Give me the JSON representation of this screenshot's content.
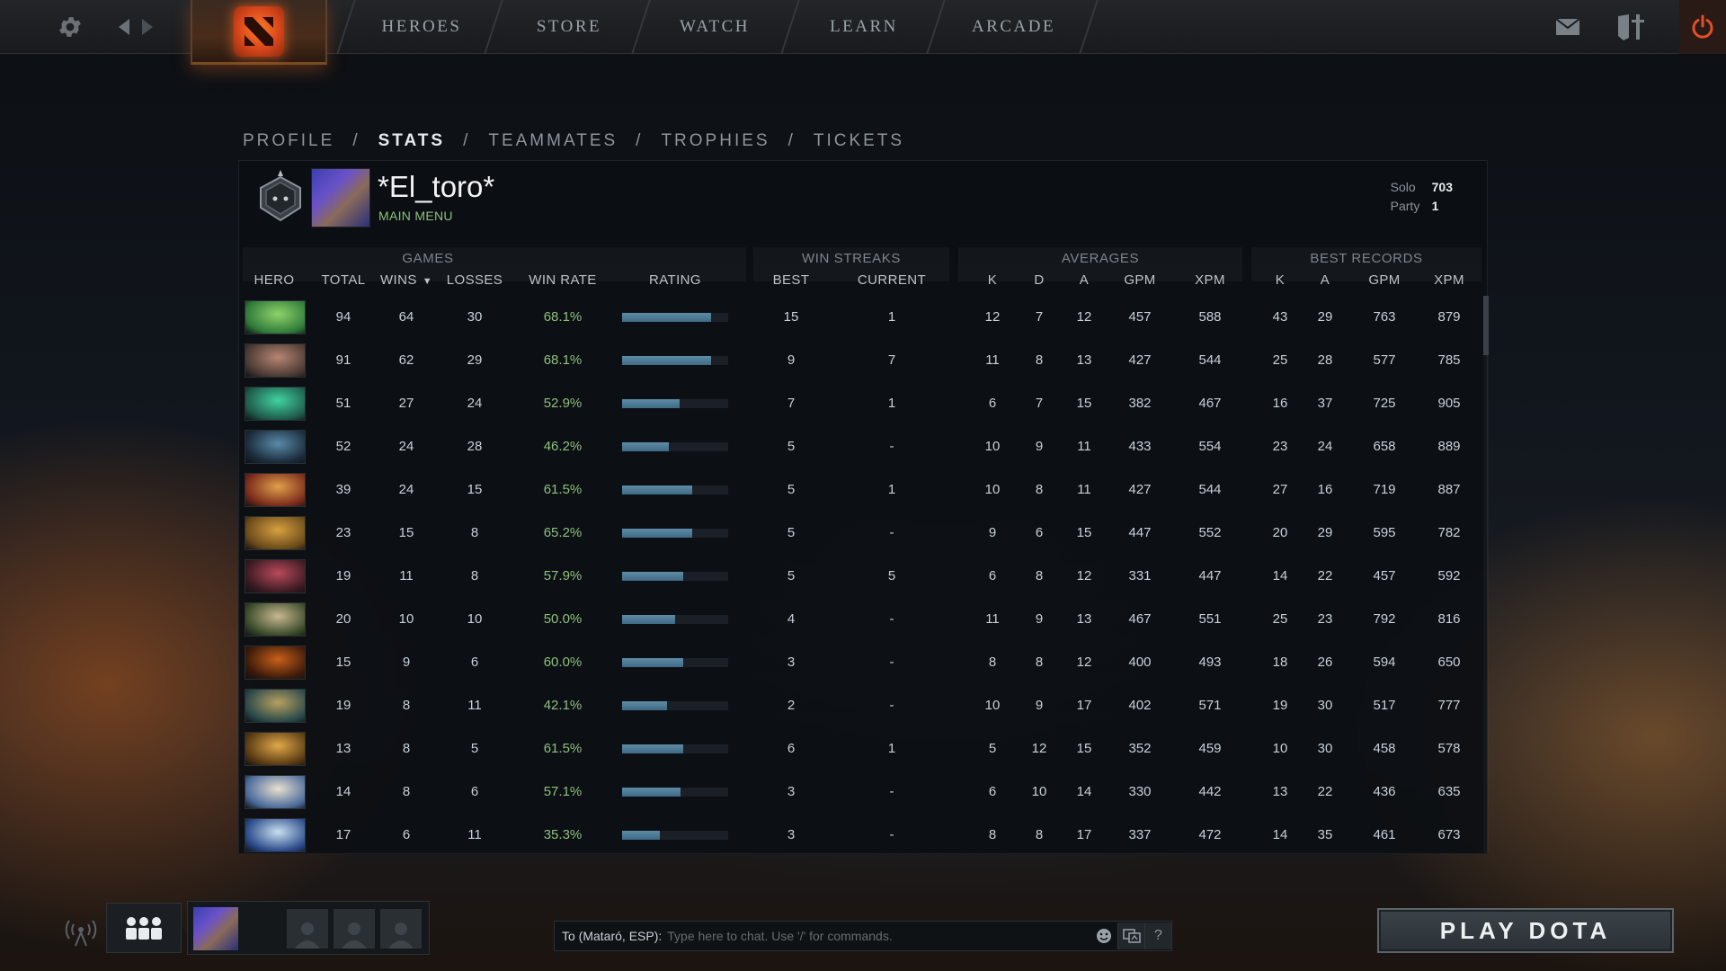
{
  "topnav": {
    "items": [
      "HEROES",
      "STORE",
      "WATCH",
      "LEARN",
      "ARCADE"
    ],
    "icons": {
      "settings": "gear-icon",
      "back": "arrow-left-icon",
      "forward": "arrow-right-icon",
      "logo": "dota-logo-icon",
      "mail": "mail-icon",
      "armory": "armory-icon",
      "power": "power-icon"
    },
    "accent_color": "#d7461a"
  },
  "profile_nav": {
    "items": [
      "PROFILE",
      "STATS",
      "TEAMMATES",
      "TROPHIES",
      "TICKETS"
    ],
    "active": "STATS"
  },
  "player": {
    "name": "*El_toro*",
    "status": "MAIN MENU",
    "solo_label": "Solo",
    "solo_value": "703",
    "party_label": "Party",
    "party_value": "1"
  },
  "table": {
    "group_headers": {
      "games": "GAMES",
      "win_streaks": "WIN STREAKS",
      "averages": "AVERAGES",
      "best_records": "BEST RECORDS"
    },
    "columns": {
      "hero": "HERO",
      "total": "TOTAL",
      "wins": "WINS",
      "losses": "LOSSES",
      "win_rate": "WIN RATE",
      "rating": "RATING",
      "best": "BEST",
      "current": "CURRENT",
      "avg_k": "K",
      "avg_d": "D",
      "avg_a": "A",
      "avg_gpm": "GPM",
      "avg_xpm": "XPM",
      "best_k": "K",
      "best_a": "A",
      "best_gpm": "GPM",
      "best_xpm": "XPM"
    },
    "sorted_by": "WINS",
    "rows": [
      {
        "total": "94",
        "wins": "64",
        "losses": "30",
        "win_rate": "68.1%",
        "rating": 0.84,
        "best": "15",
        "current": "1",
        "avg_k": "12",
        "avg_d": "7",
        "avg_a": "12",
        "avg_gpm": "457",
        "avg_xpm": "588",
        "best_k": "43",
        "best_a": "29",
        "best_gpm": "763",
        "best_xpm": "879",
        "c1": "#2f7a3a",
        "c2": "#8fd36a"
      },
      {
        "total": "91",
        "wins": "62",
        "losses": "29",
        "win_rate": "68.1%",
        "rating": 0.84,
        "best": "9",
        "current": "7",
        "avg_k": "11",
        "avg_d": "8",
        "avg_a": "13",
        "avg_gpm": "427",
        "avg_xpm": "544",
        "best_k": "25",
        "best_a": "28",
        "best_gpm": "577",
        "best_xpm": "785",
        "c1": "#4a3a34",
        "c2": "#b88672"
      },
      {
        "total": "51",
        "wins": "27",
        "losses": "24",
        "win_rate": "52.9%",
        "rating": 0.54,
        "best": "7",
        "current": "1",
        "avg_k": "6",
        "avg_d": "7",
        "avg_a": "15",
        "avg_gpm": "382",
        "avg_xpm": "467",
        "best_k": "16",
        "best_a": "37",
        "best_gpm": "725",
        "best_xpm": "905",
        "c1": "#1f5a4a",
        "c2": "#3fd3a0"
      },
      {
        "total": "52",
        "wins": "24",
        "losses": "28",
        "win_rate": "46.2%",
        "rating": 0.44,
        "best": "5",
        "current": "-",
        "avg_k": "10",
        "avg_d": "9",
        "avg_a": "11",
        "avg_gpm": "433",
        "avg_xpm": "554",
        "best_k": "23",
        "best_a": "24",
        "best_gpm": "658",
        "best_xpm": "889",
        "c1": "#1a2a3a",
        "c2": "#5a8aa8"
      },
      {
        "total": "39",
        "wins": "24",
        "losses": "15",
        "win_rate": "61.5%",
        "rating": 0.66,
        "best": "5",
        "current": "1",
        "avg_k": "10",
        "avg_d": "8",
        "avg_a": "11",
        "avg_gpm": "427",
        "avg_xpm": "544",
        "best_k": "27",
        "best_a": "16",
        "best_gpm": "719",
        "best_xpm": "887",
        "c1": "#7a2a1a",
        "c2": "#e0a04a"
      },
      {
        "total": "23",
        "wins": "15",
        "losses": "8",
        "win_rate": "65.2%",
        "rating": 0.66,
        "best": "5",
        "current": "-",
        "avg_k": "9",
        "avg_d": "6",
        "avg_a": "15",
        "avg_gpm": "447",
        "avg_xpm": "552",
        "best_k": "20",
        "best_a": "29",
        "best_gpm": "595",
        "best_xpm": "782",
        "c1": "#6a4a1a",
        "c2": "#d8a040"
      },
      {
        "total": "19",
        "wins": "11",
        "losses": "8",
        "win_rate": "57.9%",
        "rating": 0.58,
        "best": "5",
        "current": "5",
        "avg_k": "6",
        "avg_d": "8",
        "avg_a": "12",
        "avg_gpm": "331",
        "avg_xpm": "447",
        "best_k": "14",
        "best_a": "22",
        "best_gpm": "457",
        "best_xpm": "592",
        "c1": "#3a1a22",
        "c2": "#b84a5a"
      },
      {
        "total": "20",
        "wins": "10",
        "losses": "10",
        "win_rate": "50.0%",
        "rating": 0.5,
        "best": "4",
        "current": "-",
        "avg_k": "11",
        "avg_d": "9",
        "avg_a": "13",
        "avg_gpm": "467",
        "avg_xpm": "551",
        "best_k": "25",
        "best_a": "23",
        "best_gpm": "792",
        "best_xpm": "816",
        "c1": "#3a4a2a",
        "c2": "#c8b890"
      },
      {
        "total": "15",
        "wins": "9",
        "losses": "6",
        "win_rate": "60.0%",
        "rating": 0.58,
        "best": "3",
        "current": "-",
        "avg_k": "8",
        "avg_d": "8",
        "avg_a": "12",
        "avg_gpm": "400",
        "avg_xpm": "493",
        "best_k": "18",
        "best_a": "26",
        "best_gpm": "594",
        "best_xpm": "650",
        "c1": "#3a1a0a",
        "c2": "#c8601a"
      },
      {
        "total": "19",
        "wins": "8",
        "losses": "11",
        "win_rate": "42.1%",
        "rating": 0.42,
        "best": "2",
        "current": "-",
        "avg_k": "10",
        "avg_d": "9",
        "avg_a": "17",
        "avg_gpm": "402",
        "avg_xpm": "571",
        "best_k": "19",
        "best_a": "30",
        "best_gpm": "517",
        "best_xpm": "777",
        "c1": "#2a4a4a",
        "c2": "#b8a060"
      },
      {
        "total": "13",
        "wins": "8",
        "losses": "5",
        "win_rate": "61.5%",
        "rating": 0.58,
        "best": "6",
        "current": "1",
        "avg_k": "5",
        "avg_d": "12",
        "avg_a": "15",
        "avg_gpm": "352",
        "avg_xpm": "459",
        "best_k": "10",
        "best_a": "30",
        "best_gpm": "458",
        "best_xpm": "578",
        "c1": "#5a3a12",
        "c2": "#e0a84a"
      },
      {
        "total": "14",
        "wins": "8",
        "losses": "6",
        "win_rate": "57.1%",
        "rating": 0.55,
        "best": "3",
        "current": "-",
        "avg_k": "6",
        "avg_d": "10",
        "avg_a": "14",
        "avg_gpm": "330",
        "avg_xpm": "442",
        "best_k": "13",
        "best_a": "22",
        "best_gpm": "436",
        "best_xpm": "635",
        "c1": "#4a6a9a",
        "c2": "#e8e0d0"
      },
      {
        "total": "17",
        "wins": "6",
        "losses": "11",
        "win_rate": "35.3%",
        "rating": 0.36,
        "best": "3",
        "current": "-",
        "avg_k": "8",
        "avg_d": "8",
        "avg_a": "17",
        "avg_gpm": "337",
        "avg_xpm": "472",
        "best_k": "14",
        "best_a": "35",
        "best_gpm": "461",
        "best_xpm": "673",
        "c1": "#2a4a8a",
        "c2": "#c8e0f0"
      }
    ]
  },
  "chat": {
    "to_label": "To (Mataró, ESP):",
    "placeholder": "Type here to chat. Use '/' for commands.",
    "help": "?"
  },
  "play_button": {
    "label": "PLAY DOTA"
  }
}
